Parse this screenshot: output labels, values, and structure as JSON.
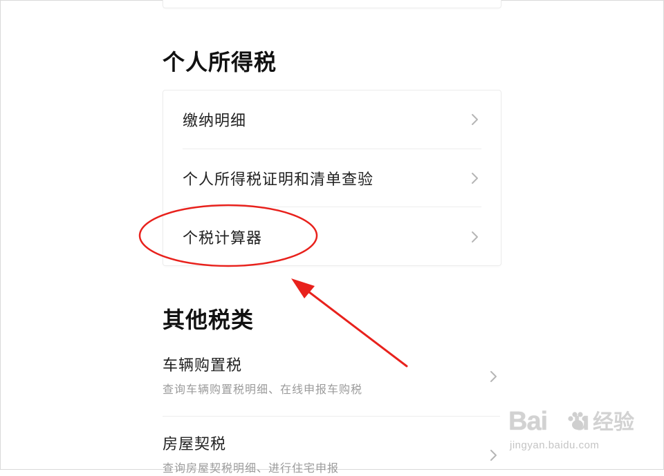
{
  "personal_income_tax": {
    "title": "个人所得税",
    "items": [
      {
        "label": "缴纳明细"
      },
      {
        "label": "个人所得税证明和清单查验"
      },
      {
        "label": "个税计算器"
      }
    ]
  },
  "other_taxes": {
    "title": "其他税类",
    "items": [
      {
        "name": "车辆购置税",
        "desc": "查询车辆购置税明细、在线申报车购税"
      },
      {
        "name": "房屋契税",
        "desc": "查询房屋契税明细、进行住宅申报"
      }
    ]
  },
  "annotation": {
    "color": "#e8211c"
  },
  "watermark": {
    "brand": "Bai",
    "brand_suffix": "u",
    "cn": "经验",
    "url": "jingyan.baidu.com"
  },
  "icons": {
    "chevron": "chevron-right-icon"
  }
}
